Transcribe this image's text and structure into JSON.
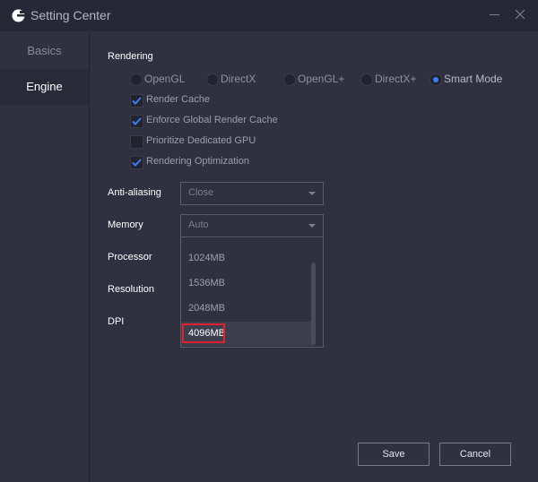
{
  "window": {
    "title": "Setting Center",
    "logo_icon": "app-logo-icon",
    "minimize_icon": "minimize-icon",
    "close_icon": "close-icon"
  },
  "sidebar": {
    "items": [
      {
        "label": "Basics",
        "active": false
      },
      {
        "label": "Engine",
        "active": true
      }
    ]
  },
  "rendering": {
    "label": "Rendering",
    "modes": [
      {
        "label": "OpenGL",
        "checked": false
      },
      {
        "label": "DirectX",
        "checked": false
      },
      {
        "label": "OpenGL+",
        "checked": false
      },
      {
        "label": "DirectX+",
        "checked": false
      },
      {
        "label": "Smart Mode",
        "checked": true
      }
    ],
    "options": [
      {
        "label": "Render Cache",
        "checked": true
      },
      {
        "label": "Enforce Global Render Cache",
        "checked": true
      },
      {
        "label": "Prioritize Dedicated GPU",
        "checked": false
      },
      {
        "label": "Rendering Optimization",
        "checked": true
      }
    ]
  },
  "fields": {
    "anti_aliasing": {
      "label": "Anti-aliasing",
      "value": "Close"
    },
    "memory": {
      "label": "Memory",
      "value": "Auto"
    },
    "processor": {
      "label": "Processor"
    },
    "resolution": {
      "label": "Resolution"
    },
    "dpi": {
      "label": "DPI"
    }
  },
  "memory_dropdown": {
    "options": [
      "1024MB",
      "1536MB",
      "2048MB",
      "4096MB"
    ],
    "hovered": "4096MB",
    "highlight_color": "#e0202b"
  },
  "buttons": {
    "save": "Save",
    "cancel": "Cancel"
  },
  "colors": {
    "accent": "#3d7ef2",
    "background": "#2f3141",
    "titlebar": "#262836"
  }
}
